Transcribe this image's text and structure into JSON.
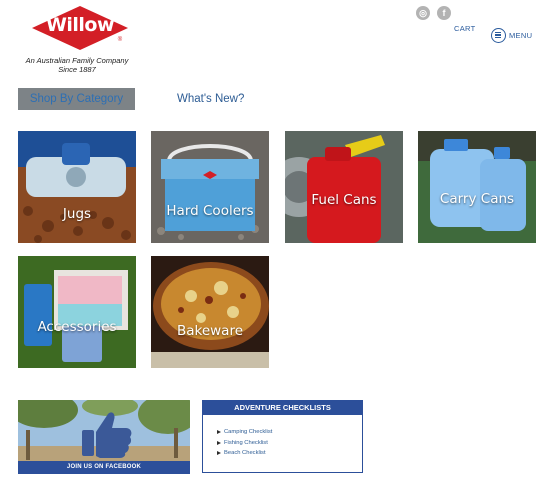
{
  "header": {
    "brand": "Willow",
    "registered_mark": "®",
    "tagline_line1": "An Australian Family Company",
    "tagline_line2": "Since 1887",
    "instagram_glyph": "◎",
    "facebook_glyph": "f",
    "cart_label": "CART",
    "menu_label": "MENU",
    "brand_color": "#d31f26",
    "accent_color": "#2a5b9d"
  },
  "tabs": {
    "shop_by_category": "Shop By Category",
    "whats_new": "What's New?"
  },
  "categories": [
    {
      "label": "Jugs"
    },
    {
      "label": "Hard Coolers"
    },
    {
      "label": "Fuel Cans"
    },
    {
      "label": "Carry Cans"
    },
    {
      "label": "Accessories"
    },
    {
      "label": "Bakeware"
    }
  ],
  "facebook_promo": {
    "label": "JOIN US ON FACEBOOK"
  },
  "checklists": {
    "title": "ADVENTURE CHECKLISTS",
    "items": [
      "Camping Checklist",
      "Fishing Checklist",
      "Beach Checklist"
    ]
  }
}
